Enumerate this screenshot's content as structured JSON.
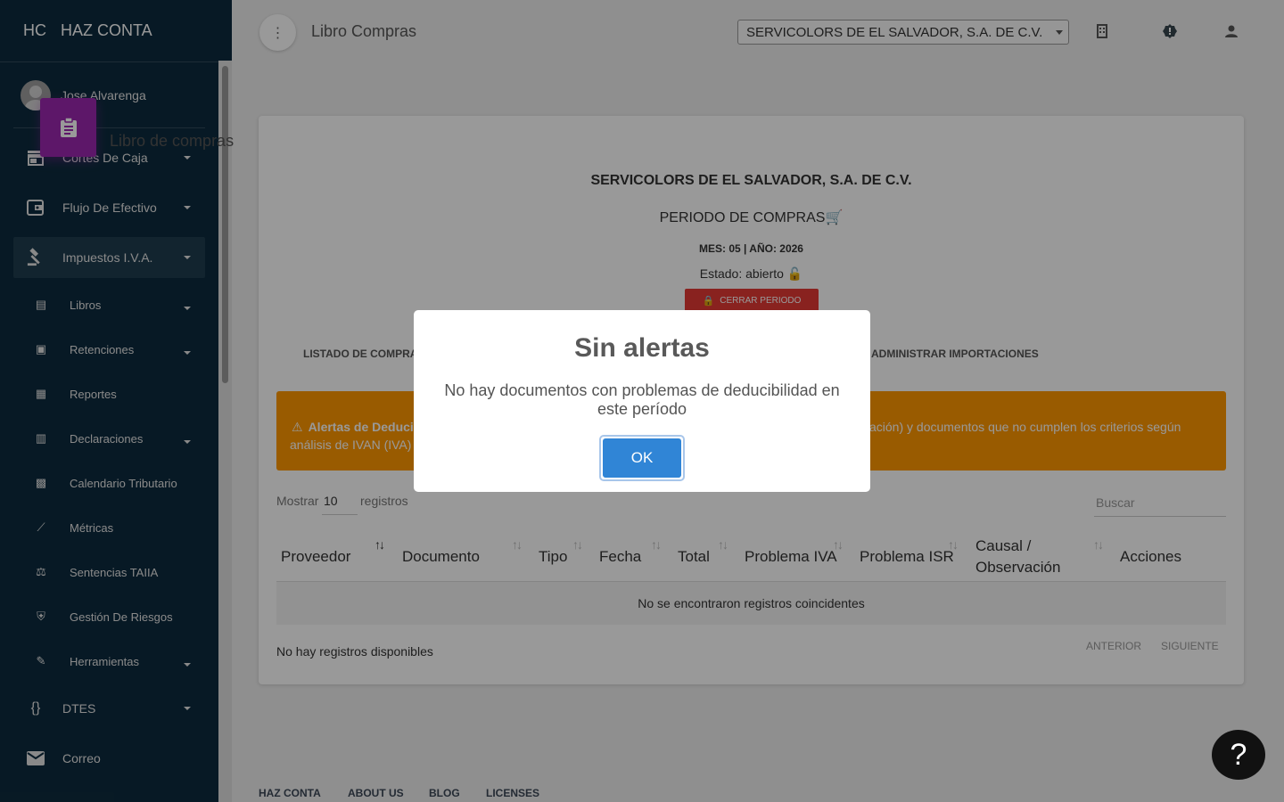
{
  "brand": {
    "mini": "HC",
    "name": "HAZ CONTA"
  },
  "user": {
    "name": "Jose Alvarenga"
  },
  "sidebar": {
    "items": [
      {
        "label": "Cortes De Caja"
      },
      {
        "label": "Flujo De Efectivo"
      },
      {
        "label": "Impuestos I.V.A."
      }
    ],
    "subitems": [
      {
        "label": "Libros"
      },
      {
        "label": "Retenciones"
      },
      {
        "label": "Reportes"
      },
      {
        "label": "Declaraciones"
      },
      {
        "label": "Calendario Tributario"
      },
      {
        "label": "Métricas"
      },
      {
        "label": "Sentencias TAIIA"
      },
      {
        "label": "Gestión De Riesgos"
      },
      {
        "label": "Herramientas"
      }
    ],
    "bottom": [
      {
        "label": "DTES"
      },
      {
        "label": "Correo"
      }
    ]
  },
  "header": {
    "title": "Libro Compras",
    "company_select": "SERVICOLORS DE EL SALVADOR, S.A. DE C.V."
  },
  "card": {
    "title": "Libro de compras",
    "company": "SERVICOLORS DE EL SALVADOR, S.A. DE C.V.",
    "period_label": "PERIODO DE COMPRAS",
    "mes": "MES: 05 | AÑO: 2026",
    "estado": "Estado: abierto",
    "close_button": "CERRAR PERIODO",
    "tabs": [
      "LISTADO DE COMPRAS",
      "ADMINISTRAR IMPORTACIONES"
    ],
    "alert_title": "Alertas de Deduci",
    "alert_text_right": "vación) y documentos que no cumplen los criterios según",
    "alert_text_line2": "análisis de IVAN (IVA) y",
    "mostrar": "Mostrar",
    "length": "10",
    "registros": "registros",
    "search_placeholder": "Buscar",
    "columns": [
      "Proveedor",
      "Documento",
      "Tipo",
      "Fecha",
      "Total",
      "Problema IVA",
      "Problema ISR",
      "Causal /",
      "Observación",
      "Acciones"
    ],
    "empty": "No se encontraron registros coincidentes",
    "info": "No hay registros disponibles",
    "prev": "ANTERIOR",
    "next": "SIGUIENTE"
  },
  "footer": {
    "links": [
      "HAZ CONTA",
      "ABOUT US",
      "BLOG",
      "LICENSES"
    ]
  },
  "modal": {
    "title": "Sin alertas",
    "text": "No hay documentos con problemas de deducibilidad en este período",
    "ok": "OK"
  },
  "help": {
    "label": "?"
  },
  "colors": {
    "sidebar": "#0d2b3e",
    "accent_purple": "#9c27b0",
    "alert": "#ff9800",
    "danger": "#e53935",
    "ok_button": "#3085d6"
  }
}
